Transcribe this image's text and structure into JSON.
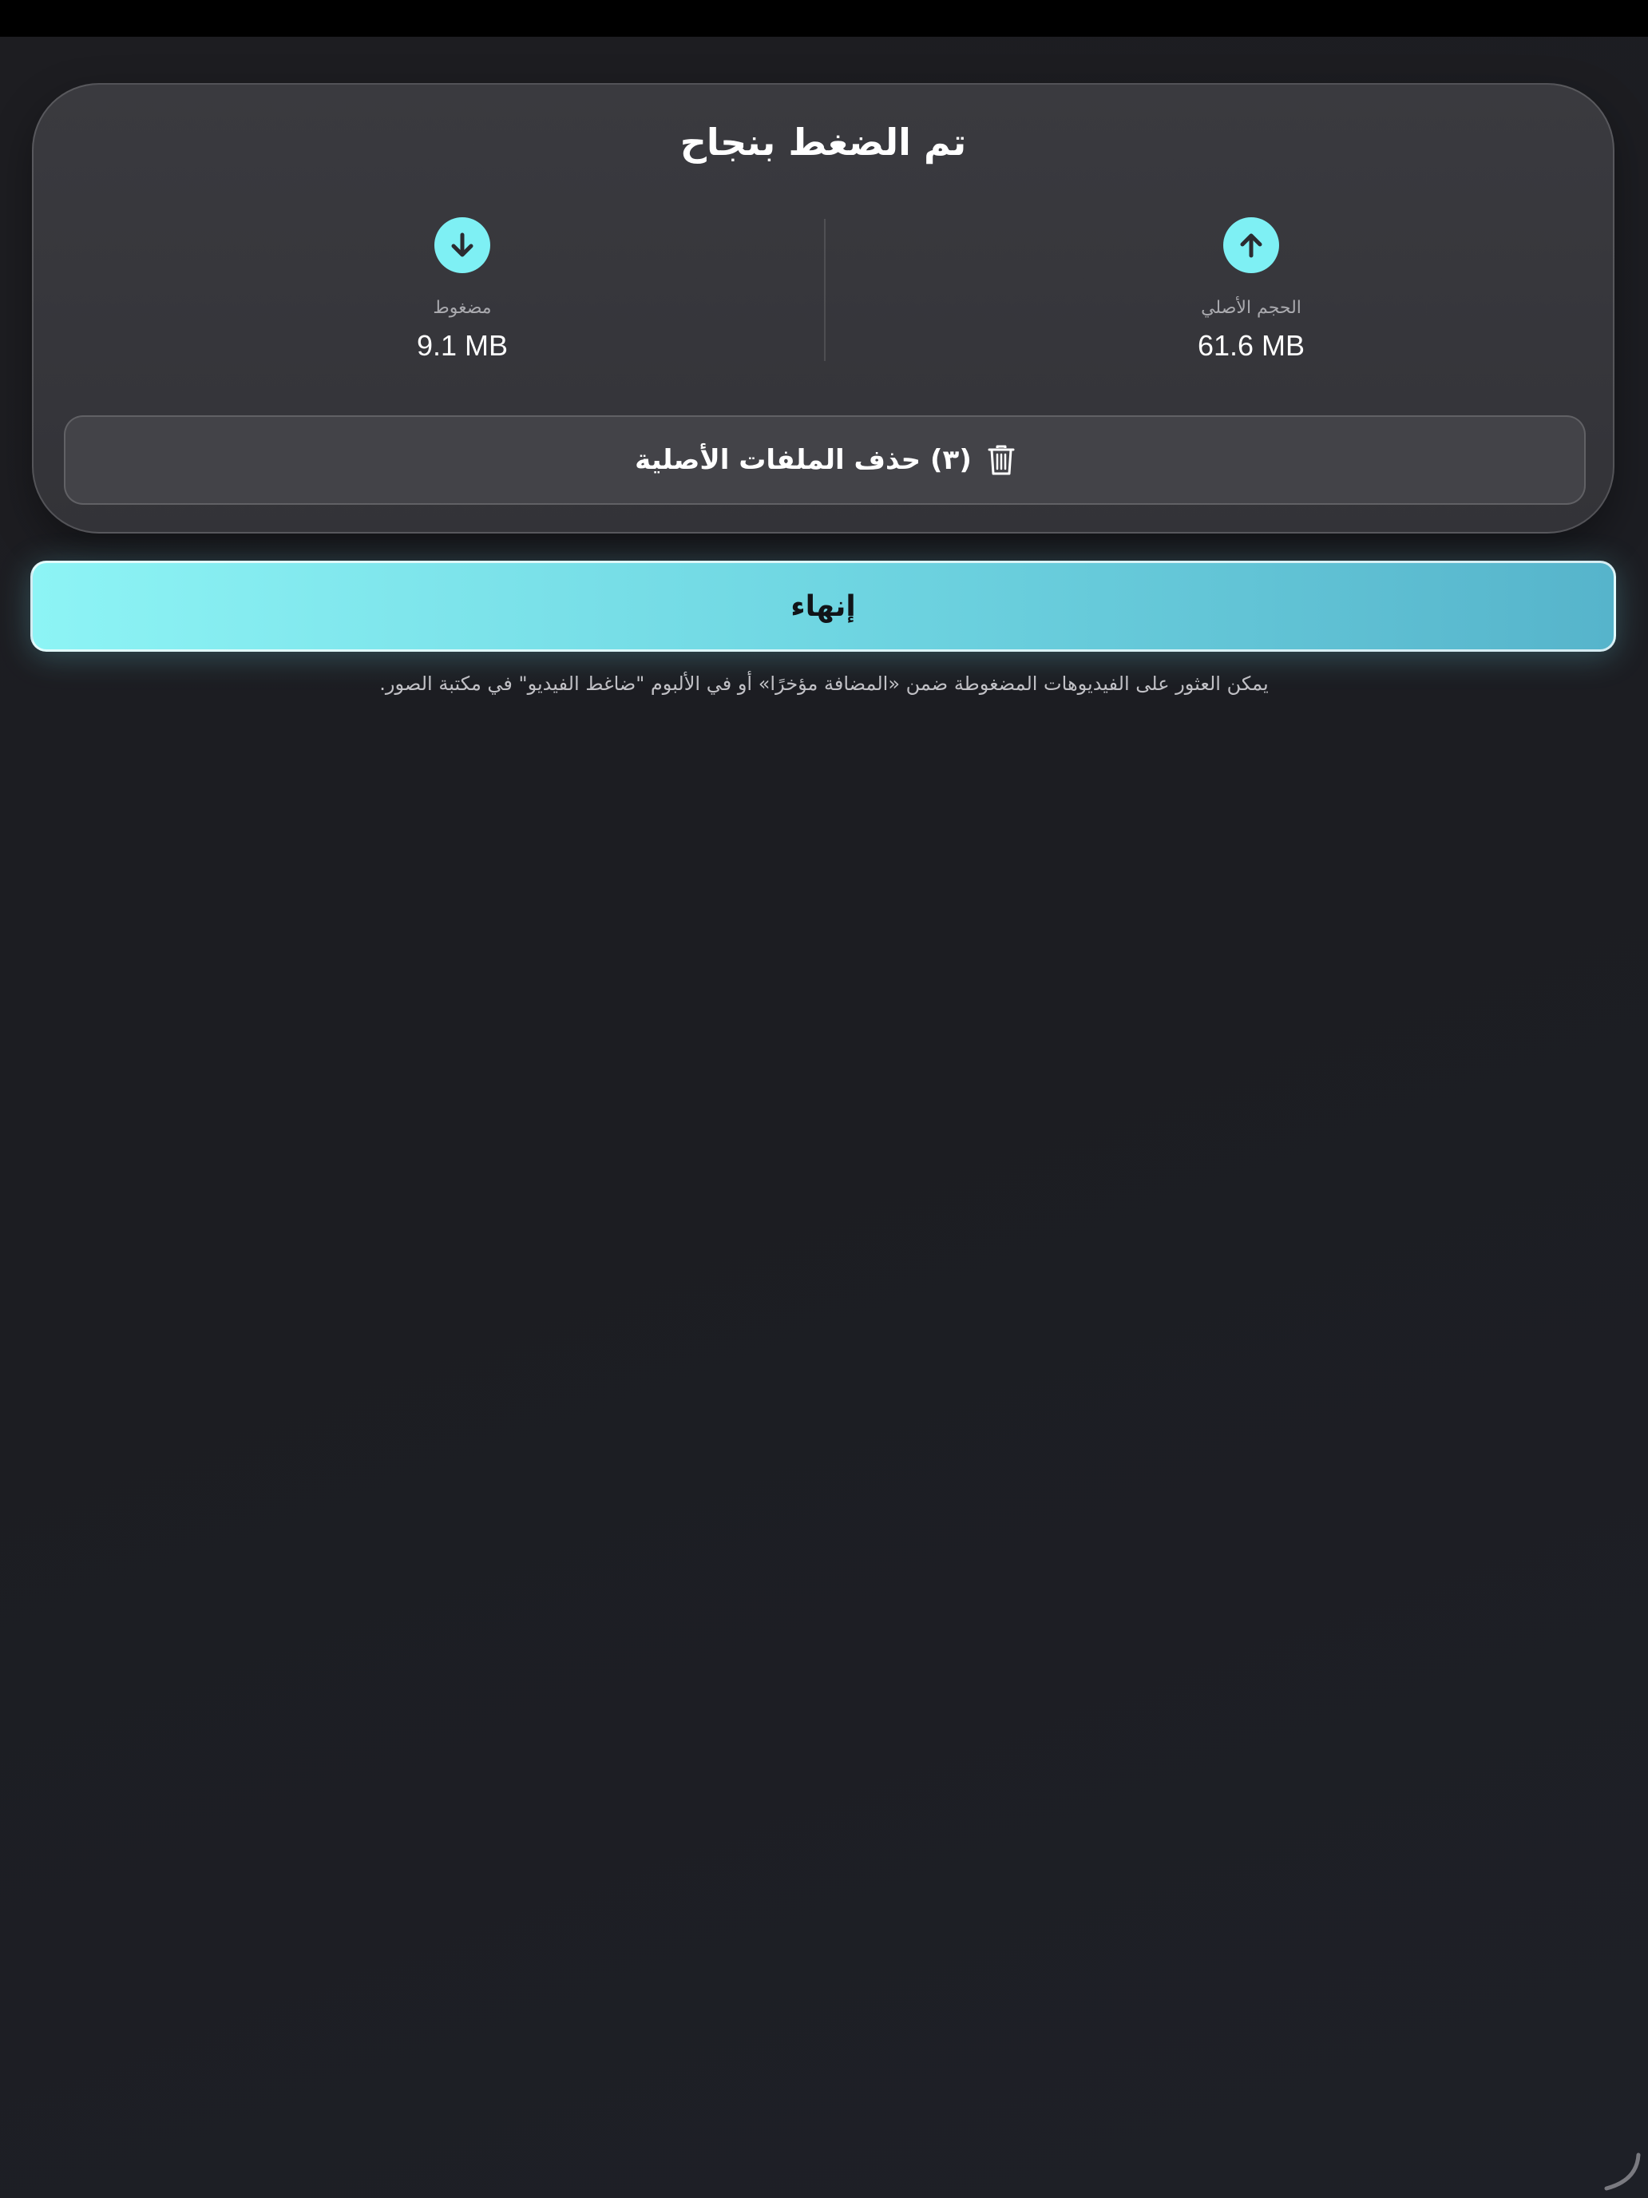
{
  "result": {
    "title": "تم الضغط بنجاح",
    "original": {
      "label": "الحجم الأصلي",
      "value": "61.6 MB",
      "icon": "arrow-up-icon"
    },
    "compressed": {
      "label": "مضغوط",
      "value": "9.1 MB",
      "icon": "arrow-down-icon"
    },
    "delete_label": "(٣) حذف الملفات الأصلية",
    "delete_icon": "trash-icon"
  },
  "finish_label": "إنهاء",
  "footer_note": "يمكن العثور على الفيديوهات المضغوطة ضمن «المضافة مؤخرًا» أو في الألبوم \"ضاغط الفيديو\" في مكتبة الصور.",
  "colors": {
    "accent": "#7ef0f4",
    "background": "#1d1d21",
    "card": "#38383d"
  }
}
